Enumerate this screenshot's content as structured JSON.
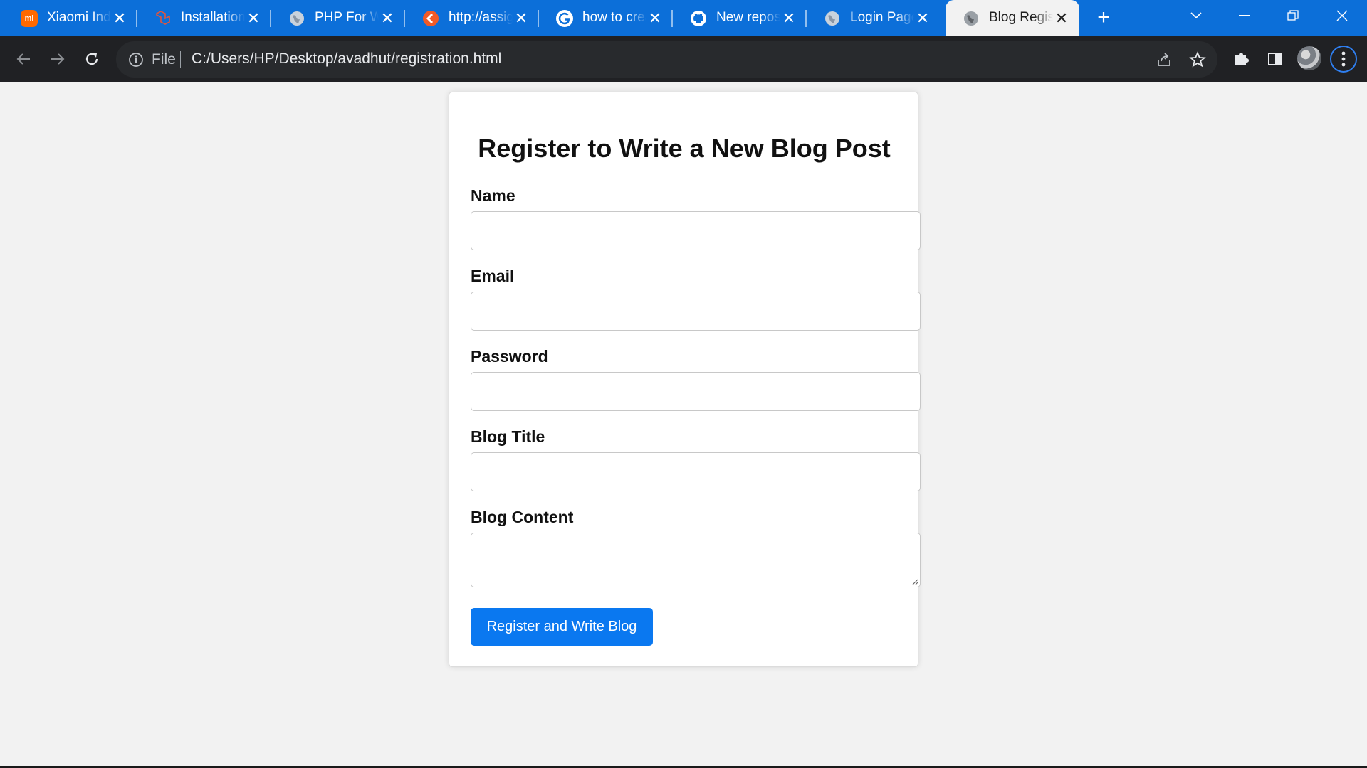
{
  "browser": {
    "tabs": [
      {
        "title": "Xiaomi India",
        "favicon": "xiaomi-mi-icon"
      },
      {
        "title": "Installation",
        "favicon": "laravel-icon"
      },
      {
        "title": "PHP For Windows",
        "favicon": "globe-icon"
      },
      {
        "title": "http://assignment",
        "favicon": "orange-arrow-icon"
      },
      {
        "title": "how to create",
        "favicon": "google-icon"
      },
      {
        "title": "New repository",
        "favicon": "github-icon"
      },
      {
        "title": "Login Page",
        "favicon": "globe-icon"
      },
      {
        "title": "Blog Registration",
        "favicon": "globe-icon",
        "active": true
      }
    ],
    "favicon_text": {
      "xiaomi": "mi"
    },
    "address": {
      "scheme_label": "File",
      "url": "C:/Users/HP/Desktop/avadhut/registration.html"
    },
    "colors": {
      "tab_strip": "#0c6fd9",
      "toolbar": "#202124",
      "accent": "#2f7ff0"
    }
  },
  "page": {
    "heading": "Register to Write a New Blog Post",
    "fields": {
      "name": {
        "label": "Name",
        "value": ""
      },
      "email": {
        "label": "Email",
        "value": ""
      },
      "password": {
        "label": "Password",
        "value": ""
      },
      "blog_title": {
        "label": "Blog Title",
        "value": ""
      },
      "blog_content": {
        "label": "Blog Content",
        "value": ""
      }
    },
    "submit_label": "Register and Write Blog",
    "colors": {
      "button": "#0a78f0",
      "background": "#f2f2f2"
    }
  }
}
